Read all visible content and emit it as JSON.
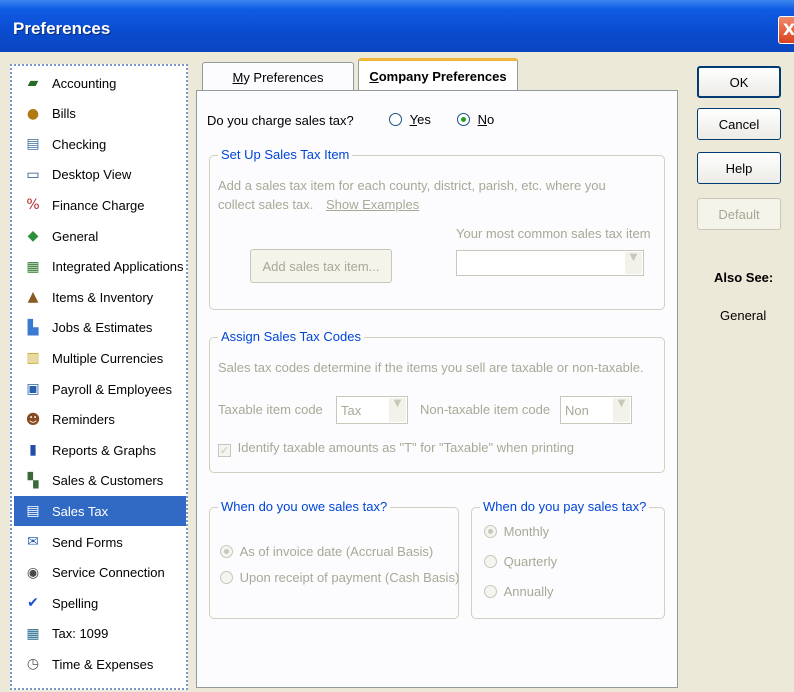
{
  "window": {
    "title": "Preferences",
    "close_glyph": "X"
  },
  "categories": [
    {
      "label": "Accounting",
      "icon": "accounting-icon",
      "glyph": "▰",
      "color": "#2a6b2a"
    },
    {
      "label": "Bills",
      "icon": "bills-icon",
      "glyph": "●",
      "color": "#b07a10"
    },
    {
      "label": "Checking",
      "icon": "checking-icon",
      "glyph": "▤",
      "color": "#3c6e9e"
    },
    {
      "label": "Desktop View",
      "icon": "desktop-view-icon",
      "glyph": "▭",
      "color": "#2b4f8f"
    },
    {
      "label": "Finance Charge",
      "icon": "finance-charge-icon",
      "glyph": "%",
      "color": "#b52a2a"
    },
    {
      "label": "General",
      "icon": "general-icon",
      "glyph": "◆",
      "color": "#2f8f3a"
    },
    {
      "label": "Integrated Applications",
      "icon": "integrated-applications-icon",
      "glyph": "▦",
      "color": "#2f7a2f"
    },
    {
      "label": "Items & Inventory",
      "icon": "items-inventory-icon",
      "glyph": "▲",
      "color": "#8a5a20"
    },
    {
      "label": "Jobs & Estimates",
      "icon": "jobs-estimates-icon",
      "glyph": "▙",
      "color": "#3a7ad0"
    },
    {
      "label": "Multiple Currencies",
      "icon": "multiple-currencies-icon",
      "glyph": "▥",
      "color": "#c7a21a"
    },
    {
      "label": "Payroll & Employees",
      "icon": "payroll-employees-icon",
      "glyph": "▣",
      "color": "#2a5fb0"
    },
    {
      "label": "Reminders",
      "icon": "reminders-icon",
      "glyph": "☻",
      "color": "#8a4a20"
    },
    {
      "label": "Reports & Graphs",
      "icon": "reports-graphs-icon",
      "glyph": "▮",
      "color": "#1f4fa8"
    },
    {
      "label": "Sales & Customers",
      "icon": "sales-customers-icon",
      "glyph": "▚",
      "color": "#3a6a3a"
    },
    {
      "label": "Sales Tax",
      "icon": "sales-tax-icon",
      "glyph": "▤",
      "color": "#ffffff",
      "selected": true
    },
    {
      "label": "Send Forms",
      "icon": "send-forms-icon",
      "glyph": "✉",
      "color": "#2a5fb0"
    },
    {
      "label": "Service Connection",
      "icon": "service-connection-icon",
      "glyph": "◉",
      "color": "#4a4a4a"
    },
    {
      "label": "Spelling",
      "icon": "spelling-icon",
      "glyph": "✔",
      "color": "#1f4fd0"
    },
    {
      "label": "Tax: 1099",
      "icon": "tax-1099-icon",
      "glyph": "▦",
      "color": "#2a6b8f"
    },
    {
      "label": "Time & Expenses",
      "icon": "time-expenses-icon",
      "glyph": "◷",
      "color": "#555555"
    }
  ],
  "tabs": {
    "my_prefs": {
      "pre": "",
      "mnemonic": "M",
      "post": "y Preferences"
    },
    "company_prefs": {
      "pre": "",
      "mnemonic": "C",
      "post": "ompany Preferences"
    }
  },
  "sales_tax": {
    "question": "Do you charge sales tax?",
    "yes": {
      "pre": "",
      "mnemonic": "Y",
      "post": "es"
    },
    "no": {
      "pre": "",
      "mnemonic": "N",
      "post": "o"
    },
    "setup_group": {
      "title": "Set Up Sales Tax Item",
      "desc_line1": "Add a sales tax item for each county, district, parish, etc. where you",
      "desc_line2": "collect sales tax.",
      "show_examples": "Show Examples",
      "common_label": "Your most common sales tax item",
      "add_button": "Add sales tax item...",
      "common_value": ""
    },
    "codes_group": {
      "title": "Assign Sales Tax Codes",
      "desc": "Sales tax codes determine if the items you sell are taxable or non-taxable.",
      "taxable_label": "Taxable item code",
      "taxable_value": "Tax",
      "nontaxable_label": "Non-taxable item code",
      "nontaxable_value": "Non",
      "identify_label": "Identify taxable amounts as \"T\" for \"Taxable\" when printing"
    },
    "owe_group": {
      "title": "When do you owe sales tax?",
      "accrual": "As of invoice date (Accrual Basis)",
      "cash": "Upon receipt of payment (Cash Basis)"
    },
    "pay_group": {
      "title": "When do you pay sales tax?",
      "monthly": "Monthly",
      "quarterly": "Quarterly",
      "annually": "Annually"
    }
  },
  "buttons": {
    "ok": "OK",
    "cancel": "Cancel",
    "help": "Help",
    "default": "Default"
  },
  "also_see": {
    "heading": "Also See:",
    "link": "General"
  }
}
